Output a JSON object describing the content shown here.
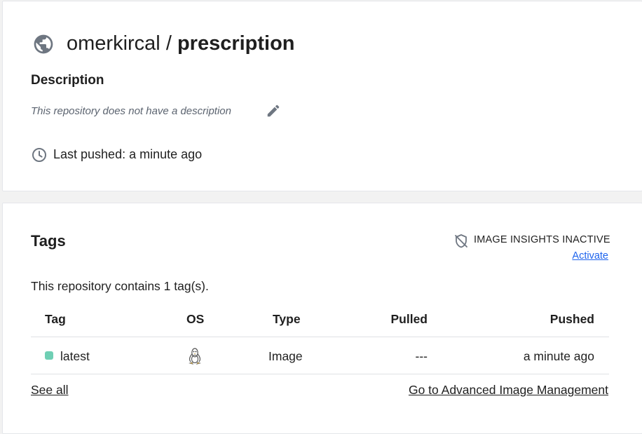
{
  "repo": {
    "namespace": "omerkircal",
    "separator": "/",
    "name": "prescription",
    "visibility_icon": "globe-icon",
    "description_heading": "Description",
    "description_text": "This repository does not have a description",
    "last_pushed": "Last pushed: a minute ago"
  },
  "tags_section": {
    "heading": "Tags",
    "insights_label": "IMAGE INSIGHTS INACTIVE",
    "activate_label": "Activate",
    "tag_count_text": "This repository contains 1 tag(s).",
    "columns": [
      "Tag",
      "OS",
      "Type",
      "Pulled",
      "Pushed"
    ],
    "rows": [
      {
        "tag": "latest",
        "os_icon": "linux-icon",
        "type": "Image",
        "pulled": "---",
        "pushed": "a minute ago",
        "status_color": "#6fcfb4"
      }
    ],
    "see_all_label": "See all",
    "advanced_label": "Go to Advanced Image Management"
  },
  "colors": {
    "link": "#1d63ed",
    "muted": "#5c6470",
    "icon": "#6e7681"
  }
}
